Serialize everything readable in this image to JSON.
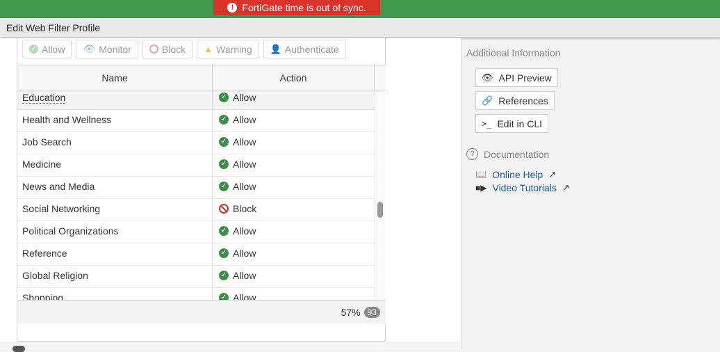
{
  "alert": {
    "text": "FortiGate time is out of sync."
  },
  "title": "Edit Web Filter Profile",
  "filter_buttons": [
    "Allow",
    "Monitor",
    "Block",
    "Warning",
    "Authenticate"
  ],
  "table": {
    "headers": {
      "name": "Name",
      "action": "Action"
    },
    "rows": [
      {
        "name": "Education",
        "action": "Allow"
      },
      {
        "name": "Health and Wellness",
        "action": "Allow"
      },
      {
        "name": "Job Search",
        "action": "Allow"
      },
      {
        "name": "Medicine",
        "action": "Allow"
      },
      {
        "name": "News and Media",
        "action": "Allow"
      },
      {
        "name": "Social Networking",
        "action": "Block"
      },
      {
        "name": "Political Organizations",
        "action": "Allow"
      },
      {
        "name": "Reference",
        "action": "Allow"
      },
      {
        "name": "Global Religion",
        "action": "Allow"
      },
      {
        "name": "Shopping",
        "action": "Allow"
      }
    ],
    "footer_percent": "57%",
    "footer_count": "93"
  },
  "side": {
    "additional_info": "Additional Information",
    "api_preview": "API Preview",
    "references": "References",
    "edit_cli": "Edit in CLI",
    "documentation": "Documentation",
    "online_help": "Online Help",
    "video_tutorials": "Video Tutorials"
  },
  "colors": {
    "topbar": "#3f9b4b",
    "alert": "#d9342b",
    "allow": "#3b8f48",
    "block": "#d0312d",
    "link": "#1f5e9e"
  }
}
